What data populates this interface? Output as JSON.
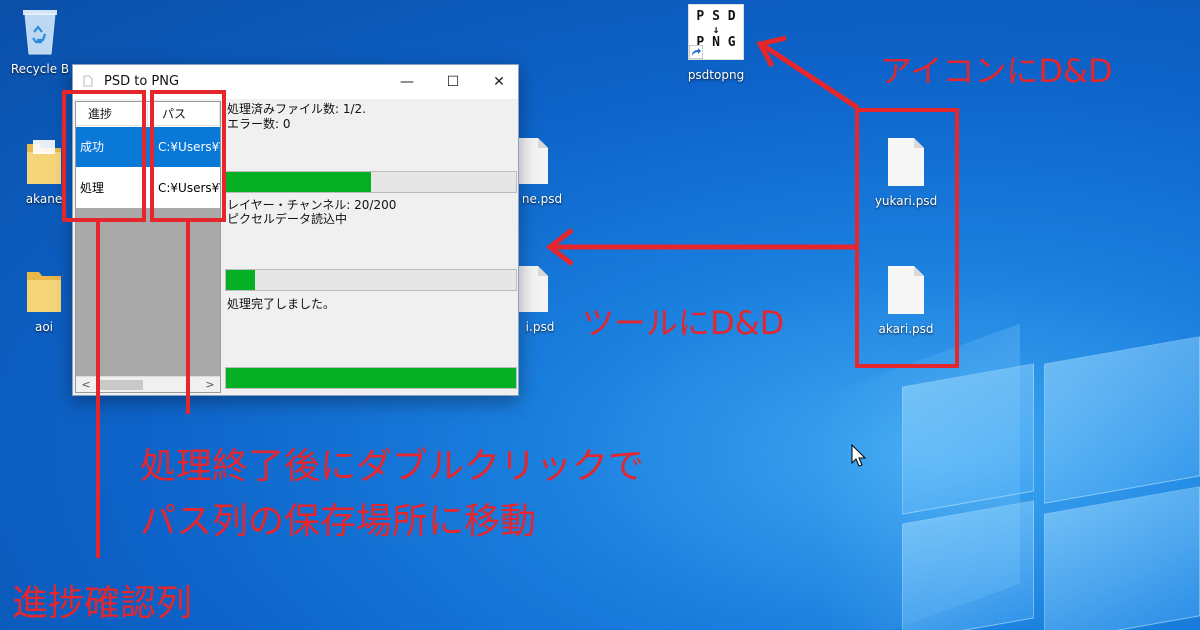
{
  "desktop": {
    "icons": [
      {
        "name": "recycle-bin",
        "label": "Recycle B"
      },
      {
        "name": "akane",
        "label": "akane"
      },
      {
        "name": "aoi",
        "label": "aoi"
      },
      {
        "name": "psdtopng",
        "label": "psdtopng",
        "shortcut_text": [
          "P S D",
          "↓",
          "P N G"
        ]
      },
      {
        "name": "yukari",
        "label": "yukari.psd"
      },
      {
        "name": "akari",
        "label": "akari.psd"
      },
      {
        "name": "hidden-file-1",
        "label": "ne.psd"
      },
      {
        "name": "hidden-file-2",
        "label": "i.psd"
      }
    ]
  },
  "window": {
    "title": "PSD to PNG",
    "minimize": "—",
    "maximize": "☐",
    "close": "✕",
    "listview": {
      "columns": [
        "進捗",
        "パス"
      ],
      "rows": [
        {
          "status": "成功",
          "path": "C:¥Users¥\\",
          "selected": true
        },
        {
          "status": "処理",
          "path": "C:¥Users¥\\",
          "selected": false
        }
      ],
      "scroll_left": "<",
      "scroll_right": ">"
    },
    "status_lines": {
      "files_processed": "処理済みファイル数: 1/2.",
      "errors": "エラー数: 0",
      "layers": "レイヤー・チャンネル: 20/200",
      "pixel_loading": "ピクセルデータ読込中",
      "done": "処理完了しました。"
    },
    "progress": {
      "files": 0.5,
      "layers": 0.1,
      "overall": 1.0
    }
  },
  "annotations": {
    "icon_dnd": "アイコンにD&D",
    "tool_dnd": "ツールにD&D",
    "double_click_line1": "処理終了後にダブルクリックで",
    "double_click_line2": "パス列の保存場所に移動",
    "progress_column": "進捗確認列"
  },
  "colors": {
    "annotation_red": "#e5262d",
    "progress_green": "#06b025",
    "selection_blue": "#0a78d7"
  }
}
